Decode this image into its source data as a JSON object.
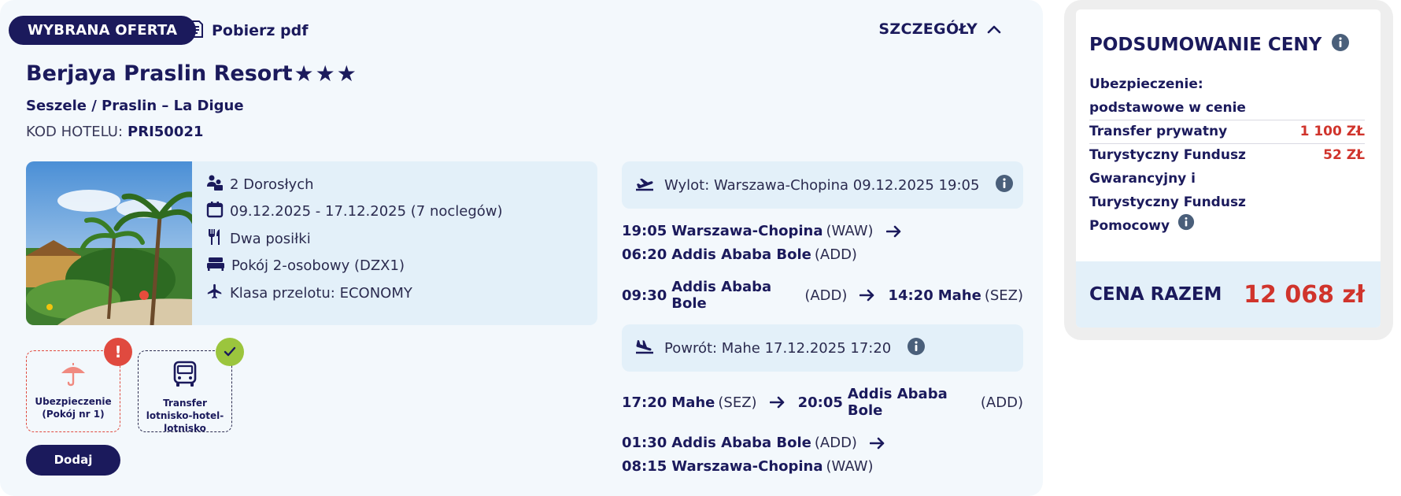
{
  "offer": {
    "badge": "WYBRANA OFERTA",
    "pdf_label": "Pobierz pdf",
    "details_label": "SZCZEGÓŁY",
    "hotel_name": "Berjaya Praslin Resort",
    "stars": 3,
    "location": "Seszele / Praslin – La Digue",
    "hotel_code_label": "KOD HOTELU:",
    "hotel_code": "PRI50021"
  },
  "info": {
    "guests": "2 Dorosłych",
    "dates": "09.12.2025 - 17.12.2025 (7 noclegów)",
    "meals": "Dwa posiłki",
    "room": "Pokój 2-osobowy (DZX1)",
    "flight_class": "Klasa przelotu: ECONOMY"
  },
  "outbound": {
    "label": "Wylot: Warszawa-Chopina",
    "datetime": "09.12.2025 19:05",
    "segments": [
      {
        "dep_time": "19:05",
        "dep_airport": "Warszawa-Chopina",
        "dep_code": "(WAW)",
        "arr_time": "06:20",
        "arr_airport": "Addis Ababa Bole",
        "arr_code": "(ADD)"
      },
      {
        "dep_time": "09:30",
        "dep_airport": "Addis Ababa Bole",
        "dep_code": "(ADD)",
        "arr_time": "14:20",
        "arr_airport": "Mahe",
        "arr_code": "(SEZ)"
      }
    ]
  },
  "return": {
    "label": "Powrót: Mahe",
    "datetime": "17.12.2025 17:20",
    "segments": [
      {
        "dep_time": "17:20",
        "dep_airport": "Mahe",
        "dep_code": "(SEZ)",
        "arr_time": "20:05",
        "arr_airport": "Addis Ababa Bole",
        "arr_code": "(ADD)"
      },
      {
        "dep_time": "01:30",
        "dep_airport": "Addis Ababa Bole",
        "dep_code": "(ADD)",
        "arr_time": "08:15",
        "arr_airport": "Warszawa-Chopina",
        "arr_code": "(WAW)"
      }
    ]
  },
  "addons": [
    {
      "label": "Ubezpieczenie (Pokój nr 1)",
      "status": "warning",
      "icon": "umbrella-icon"
    },
    {
      "label": "Transfer lotnisko-hotel-lotnisko",
      "status": "selected",
      "icon": "bus-icon"
    }
  ],
  "add_button": "Dodaj",
  "summary": {
    "title": "PODSUMOWANIE CENY",
    "insurance_label": "Ubezpieczenie:",
    "insurance_value": "podstawowe w cenie",
    "transfer_label": "Transfer prywatny",
    "transfer_price": "1 100 ZŁ",
    "fund_label_1": "Turystyczny Fundusz",
    "fund_label_2": "Gwarancyjny i",
    "fund_label_3": "Turystyczny Fundusz",
    "fund_label_4": "Pomocowy",
    "fund_price": "52 ZŁ",
    "total_label": "CENA RAZEM",
    "total_value": "12 068 zł"
  },
  "colors": {
    "navy": "#1b1a5c",
    "price_red": "#d0342c",
    "card_bg": "#f3f8fc",
    "panel_bg": "#e3f0f9",
    "warning_red": "#e04a3f",
    "ok_green": "#9bc53d",
    "info_icon": "#4a5f7a"
  }
}
